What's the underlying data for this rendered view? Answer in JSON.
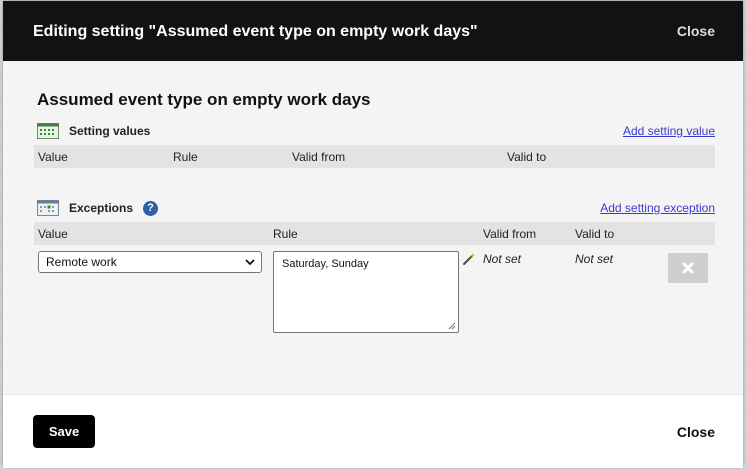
{
  "dialog": {
    "title": "Editing setting \"Assumed event type on empty work days\"",
    "close_top": "Close"
  },
  "section": {
    "title": "Assumed event type on empty work days"
  },
  "setting_values": {
    "label": "Setting values",
    "add_link": "Add setting value",
    "icon": "calendar-grid-icon",
    "columns": [
      "Value",
      "Rule",
      "Valid from",
      "Valid to"
    ]
  },
  "exceptions": {
    "label": "Exceptions",
    "help": "?",
    "add_link": "Add setting exception",
    "icon": "calendar-exception-icon",
    "columns": [
      "Value",
      "Rule",
      "Valid from",
      "Valid to"
    ],
    "rows": [
      {
        "value": "Remote work",
        "rule": "Saturday, Sunday",
        "valid_from": "Not set",
        "valid_to": "Not set"
      }
    ]
  },
  "footer": {
    "save": "Save",
    "close": "Close"
  },
  "colors": {
    "header_bg": "#121212",
    "link": "#3a3ad0",
    "save_bg": "#000000",
    "help": "#2e5fa8"
  }
}
